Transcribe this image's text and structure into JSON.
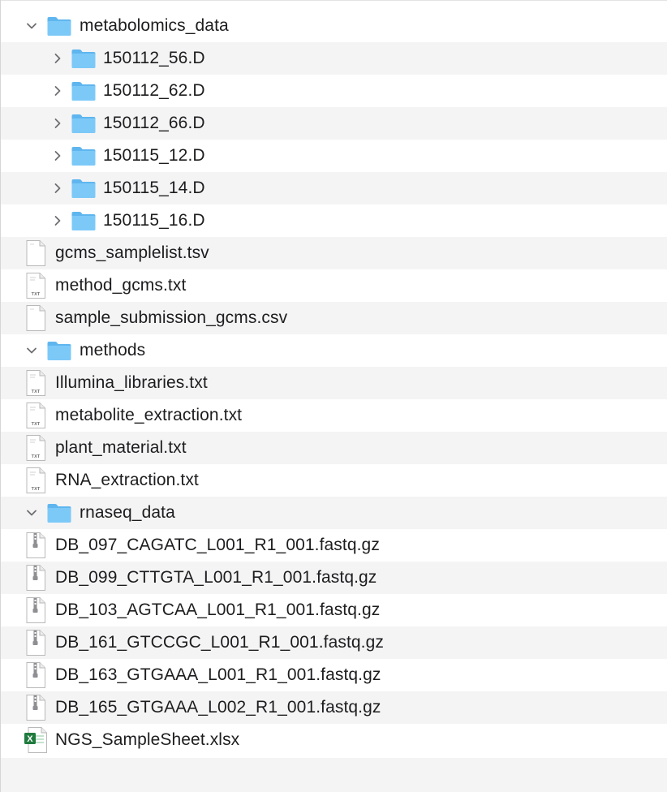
{
  "finder": {
    "rows": [
      {
        "label": "metabolomics_data",
        "kind": "folder",
        "depth": 0,
        "expanded": true
      },
      {
        "label": "150112_56.D",
        "kind": "folder",
        "depth": 1,
        "expanded": false
      },
      {
        "label": "150112_62.D",
        "kind": "folder",
        "depth": 1,
        "expanded": false
      },
      {
        "label": "150112_66.D",
        "kind": "folder",
        "depth": 1,
        "expanded": false
      },
      {
        "label": "150115_12.D",
        "kind": "folder",
        "depth": 1,
        "expanded": false
      },
      {
        "label": "150115_14.D",
        "kind": "folder",
        "depth": 1,
        "expanded": false
      },
      {
        "label": "150115_16.D",
        "kind": "folder",
        "depth": 1,
        "expanded": false
      },
      {
        "label": "gcms_samplelist.tsv",
        "kind": "doc-plain",
        "depth": 1
      },
      {
        "label": "method_gcms.txt",
        "kind": "doc-txt",
        "depth": 1
      },
      {
        "label": "sample_submission_gcms.csv",
        "kind": "doc-plain",
        "depth": 1
      },
      {
        "label": "methods",
        "kind": "folder",
        "depth": 0,
        "expanded": true
      },
      {
        "label": "Illumina_libraries.txt",
        "kind": "doc-txt",
        "depth": 1
      },
      {
        "label": "metabolite_extraction.txt",
        "kind": "doc-txt",
        "depth": 1
      },
      {
        "label": "plant_material.txt",
        "kind": "doc-txt",
        "depth": 1
      },
      {
        "label": "RNA_extraction.txt",
        "kind": "doc-txt",
        "depth": 1
      },
      {
        "label": "rnaseq_data",
        "kind": "folder",
        "depth": 0,
        "expanded": true
      },
      {
        "label": "DB_097_CAGATC_L001_R1_001.fastq.gz",
        "kind": "archive",
        "depth": 1
      },
      {
        "label": "DB_099_CTTGTA_L001_R1_001.fastq.gz",
        "kind": "archive",
        "depth": 1
      },
      {
        "label": "DB_103_AGTCAA_L001_R1_001.fastq.gz",
        "kind": "archive",
        "depth": 1
      },
      {
        "label": "DB_161_GTCCGC_L001_R1_001.fastq.gz",
        "kind": "archive",
        "depth": 1
      },
      {
        "label": "DB_163_GTGAAA_L001_R1_001.fastq.gz",
        "kind": "archive",
        "depth": 1
      },
      {
        "label": "DB_165_GTGAAA_L002_R1_001.fastq.gz",
        "kind": "archive",
        "depth": 1
      },
      {
        "label": "NGS_SampleSheet.xlsx",
        "kind": "excel",
        "depth": 1
      }
    ],
    "icons": {
      "folder": "folder-icon",
      "doc-plain": "document-icon",
      "doc-txt": "text-document-icon",
      "archive": "archive-icon",
      "excel": "excel-icon"
    },
    "doc_badge_text": "TXT",
    "excel_badge_text": "X",
    "colors": {
      "folder_back": "#5fb6ef",
      "folder_front": "#7cc9f8",
      "row_alt": "#f4f4f5",
      "text": "#1d1d1f",
      "excel_green": "#1f7a3e"
    }
  }
}
